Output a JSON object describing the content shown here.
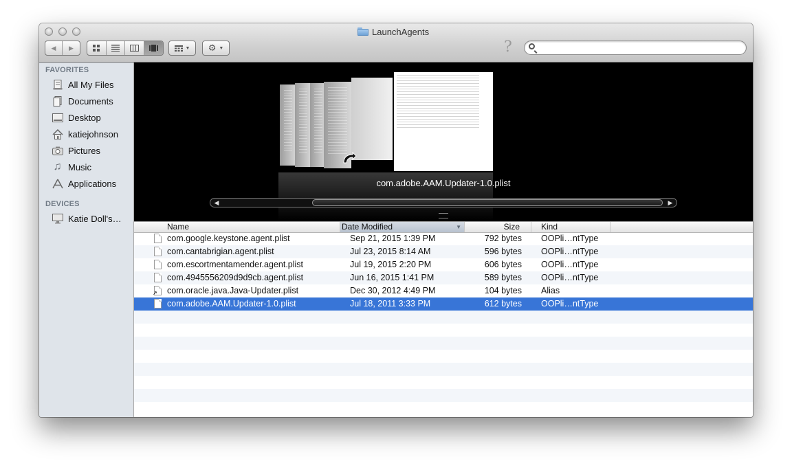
{
  "window": {
    "title": "LaunchAgents"
  },
  "toolbar": {
    "back": "◀",
    "forward": "▶",
    "views": [
      "icon-view",
      "list-view",
      "column-view",
      "coverflow-view"
    ],
    "arrange_label": "arrange",
    "action_label": "action",
    "help": "?",
    "search_placeholder": ""
  },
  "sidebar": {
    "favorites_heading": "FAVORITES",
    "favorites": [
      {
        "label": "All My Files",
        "icon": "all-files-icon"
      },
      {
        "label": "Documents",
        "icon": "documents-icon"
      },
      {
        "label": "Desktop",
        "icon": "desktop-icon"
      },
      {
        "label": "katiejohnson",
        "icon": "home-icon"
      },
      {
        "label": "Pictures",
        "icon": "camera-icon"
      },
      {
        "label": "Music",
        "icon": "music-note-icon"
      },
      {
        "label": "Applications",
        "icon": "applications-icon"
      }
    ],
    "devices_heading": "DEVICES",
    "devices": [
      {
        "label": "Katie Doll's…",
        "icon": "computer-icon"
      }
    ]
  },
  "coverflow": {
    "caption": "com.adobe.AAM.Updater-1.0.plist"
  },
  "list": {
    "columns": {
      "name": "Name",
      "date": "Date Modified",
      "size": "Size",
      "kind": "Kind"
    },
    "files": [
      {
        "name": "com.google.keystone.agent.plist",
        "date": "Sep 21, 2015 1:39 PM",
        "size": "792 bytes",
        "kind": "OOPli…ntType"
      },
      {
        "name": "com.cantabrigian.agent.plist",
        "date": "Jul 23, 2015 8:14 AM",
        "size": "596 bytes",
        "kind": "OOPli…ntType"
      },
      {
        "name": "com.escortmentamender.agent.plist",
        "date": "Jul 19, 2015 2:20 PM",
        "size": "606 bytes",
        "kind": "OOPli…ntType"
      },
      {
        "name": "com.4945556209d9d9cb.agent.plist",
        "date": "Jun 16, 2015 1:41 PM",
        "size": "589 bytes",
        "kind": "OOPli…ntType"
      },
      {
        "name": "com.oracle.java.Java-Updater.plist",
        "date": "Dec 30, 2012 4:49 PM",
        "size": "104 bytes",
        "kind": "Alias"
      },
      {
        "name": "com.adobe.AAM.Updater-1.0.plist",
        "date": "Jul 18, 2011 3:33 PM",
        "size": "612 bytes",
        "kind": "OOPli…ntType"
      }
    ],
    "selected_index": 5
  },
  "colors": {
    "selection": "#3875d7",
    "sidebar_bg": "#dfe4ea",
    "coverflow_bg": "#000000"
  }
}
